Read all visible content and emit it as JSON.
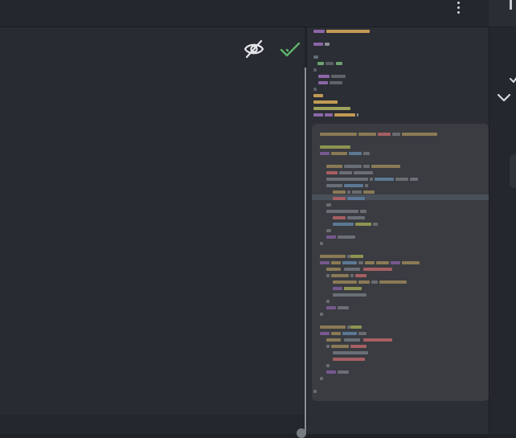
{
  "colors": {
    "background": "#1f2227",
    "panel": "#282b31",
    "minimap": "#2b2e34",
    "popover": "#3a3c41",
    "accent_check": "#5fb36a",
    "icon": "#d6d9de"
  },
  "icons": {
    "more": "more-vertical-icon",
    "visibility": "eye-off-icon",
    "confirm": "checkmark-icon",
    "panel_check": "check-icon",
    "panel_chevron": "chevron-down-icon"
  }
}
